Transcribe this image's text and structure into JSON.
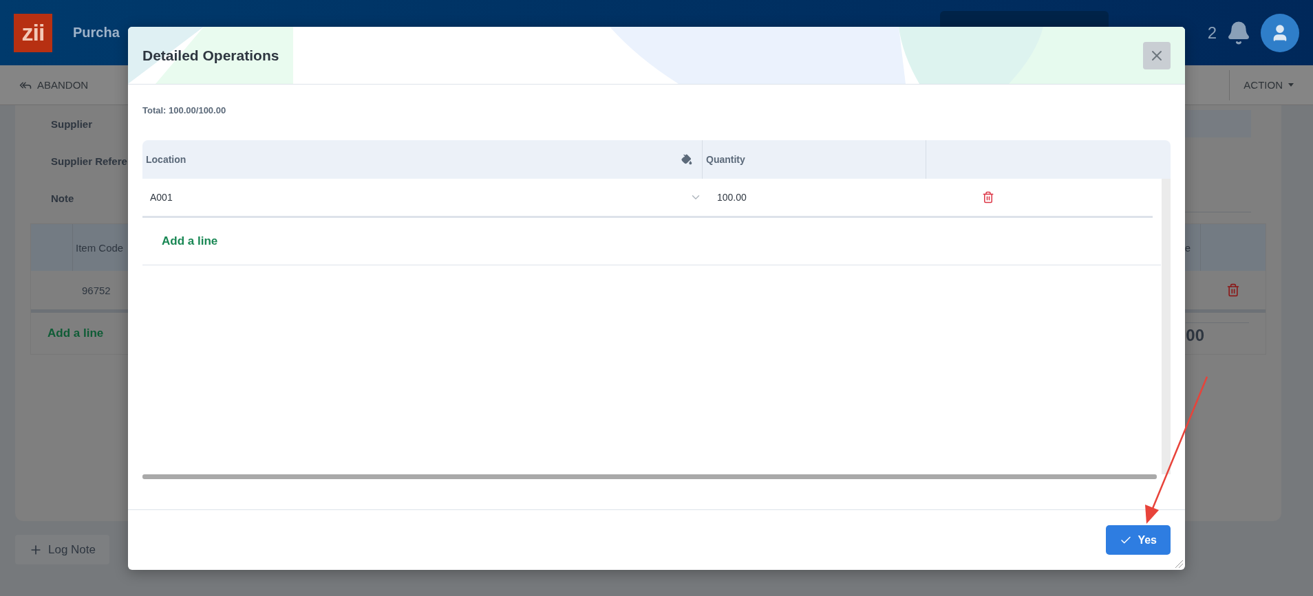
{
  "app": {
    "logo": "zii",
    "title": "Purcha",
    "notification_count": "2"
  },
  "toolbar": {
    "abandon": "ABANDON",
    "action": "ACTION"
  },
  "form": {
    "fields": [
      {
        "label": "Supplier",
        "kind": "filled"
      },
      {
        "label": "Supplier Refere",
        "kind": "plain"
      },
      {
        "label": "Note",
        "kind": "underline"
      }
    ]
  },
  "lines_table": {
    "columns": [
      "Item Code",
      "e"
    ],
    "rows": [
      {
        "item_code": "96752"
      }
    ],
    "add_line": "Add a line",
    "total": "00"
  },
  "log_note": "Log Note",
  "dialog": {
    "title": "Detailed Operations",
    "total": "Total: 100.00/100.00",
    "columns": [
      "Location",
      "Quantity"
    ],
    "rows": [
      {
        "location": "A001",
        "quantity": "100.00"
      }
    ],
    "add_line": "Add a line",
    "confirm": "Yes"
  }
}
